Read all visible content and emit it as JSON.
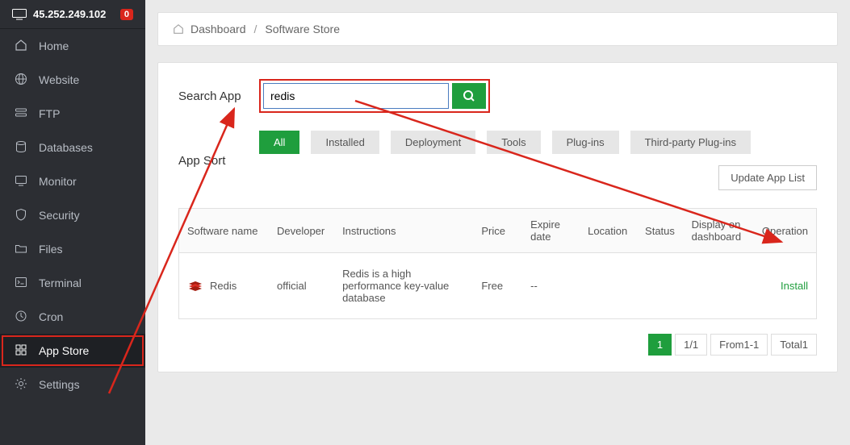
{
  "header": {
    "ip": "45.252.249.102",
    "notification_count": "0"
  },
  "sidebar": {
    "items": [
      {
        "label": "Home"
      },
      {
        "label": "Website"
      },
      {
        "label": "FTP"
      },
      {
        "label": "Databases"
      },
      {
        "label": "Monitor"
      },
      {
        "label": "Security"
      },
      {
        "label": "Files"
      },
      {
        "label": "Terminal"
      },
      {
        "label": "Cron"
      },
      {
        "label": "App Store"
      },
      {
        "label": "Settings"
      }
    ]
  },
  "breadcrumb": {
    "home": "Dashboard",
    "current": "Software Store"
  },
  "search": {
    "label": "Search App",
    "value": "redis",
    "placeholder": ""
  },
  "sort": {
    "label": "App Sort",
    "tabs": [
      "All",
      "Installed",
      "Deployment",
      "Tools",
      "Plug-ins",
      "Third-party Plug-ins"
    ],
    "update_button": "Update App List"
  },
  "table": {
    "headers": [
      "Software name",
      "Developer",
      "Instructions",
      "Price",
      "Expire date",
      "Location",
      "Status",
      "Display on dashboard",
      "Operation"
    ],
    "rows": [
      {
        "name": "Redis",
        "developer": "official",
        "instructions": "Redis is a high performance key-value database",
        "price": "Free",
        "expire_date": "--",
        "location": "",
        "status": "",
        "display": "",
        "operation": "Install"
      }
    ]
  },
  "pagination": {
    "current_page": "1",
    "total_pages": "1/1",
    "range": "From1-1",
    "total": "Total1"
  }
}
